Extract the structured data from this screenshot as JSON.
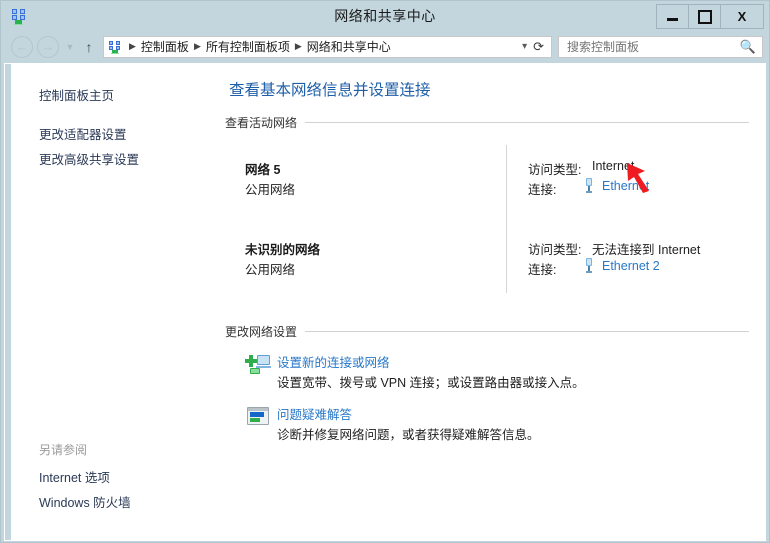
{
  "window": {
    "title": "网络和共享中心",
    "title_icon": "network-icon",
    "controls": {
      "minimize": "minimize-button",
      "maximize": "maximize-button",
      "close": "X"
    }
  },
  "navbar": {
    "back": "back-button",
    "forward": "forward-button",
    "recent_dropdown": "recent-pages-dropdown",
    "up": "up-one-level-button",
    "address_icon": "network-icon",
    "breadcrumbs": [
      "控制面板",
      "所有控制面板项",
      "网络和共享中心"
    ],
    "breadcrumb_separator": "▶",
    "address_chevron": "chevron-down-icon",
    "refresh": "refresh-icon",
    "search": {
      "placeholder": "搜索控制面板",
      "value": "",
      "icon": "search-icon"
    }
  },
  "sidebar": {
    "links": [
      "控制面板主页",
      "更改适配器设置",
      "更改高级共享设置"
    ],
    "see_also": {
      "title": "另请参阅",
      "links": [
        "Internet 选项",
        "Windows 防火墙"
      ]
    }
  },
  "main": {
    "page_title": "查看基本网络信息并设置连接",
    "active_networks_heading": "查看活动网络",
    "networks": [
      {
        "name": "网络  5",
        "type": "公用网络",
        "access_label": "访问类型:",
        "access_value": "Internet",
        "connection_label": "连接:",
        "connection_name": "Ethernet",
        "connection_icon": "network-adapter-icon"
      },
      {
        "name": "未识别的网络",
        "type": "公用网络",
        "access_label": "访问类型:",
        "access_value": "无法连接到 Internet",
        "connection_label": "连接:",
        "connection_name": "Ethernet 2",
        "connection_icon": "network-adapter-icon"
      }
    ],
    "change_settings_heading": "更改网络设置",
    "tasks": [
      {
        "icon": "new-connection-icon",
        "link": "设置新的连接或网络",
        "description": "设置宽带、拨号或 VPN 连接；或设置路由器或接入点。"
      },
      {
        "icon": "troubleshoot-icon",
        "link": "问题疑难解答",
        "description": "诊断并修复网络问题，或者获得疑难解答信息。"
      }
    ]
  },
  "annotation": {
    "arrow": "red-pointer-arrow",
    "color": "#ee1c20",
    "points_at": "Ethernet"
  },
  "colors": {
    "titlebar": "#c3d5dd",
    "link": "#2878c8",
    "heading_link": "#1f5fa8",
    "sidebar_link": "#2b3a57",
    "content_bg": "#ffffff"
  }
}
